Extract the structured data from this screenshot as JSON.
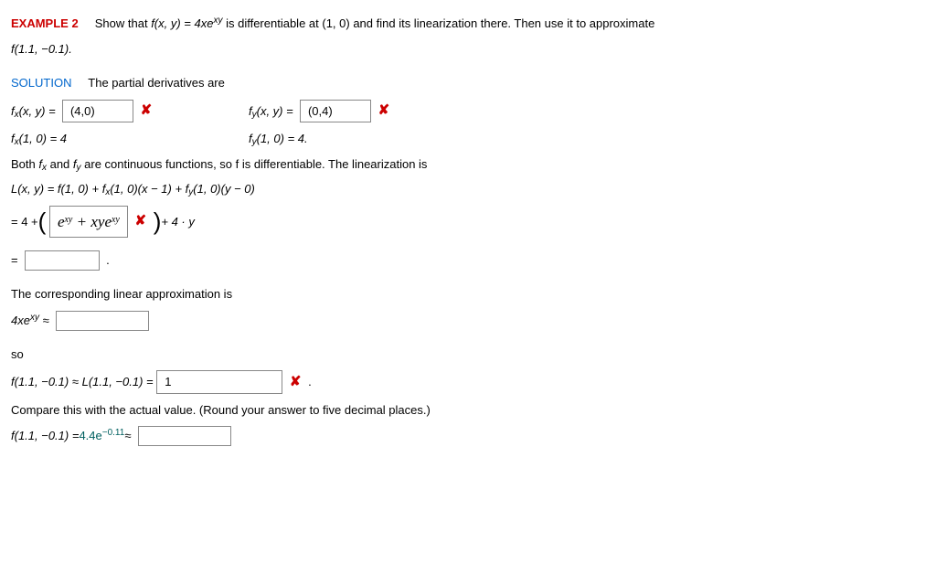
{
  "header": {
    "example_label": "EXAMPLE 2",
    "prompt_pre": "Show that ",
    "func_def": "f(x, y) = 4xe",
    "func_exp": "xy",
    "prompt_mid": " is differentiable at (1, 0) and find its linearization there. Then use it to approximate",
    "prompt_line2": "f(1.1, −0.1)."
  },
  "solution_label": "SOLUTION",
  "pd_intro": "The partial derivatives are",
  "fx_label": "f",
  "fx_args": "(x, y)  =",
  "fx_answer": "(4,0)",
  "fy_label": "f",
  "fy_args": "(x, y)  =",
  "fy_answer": "(0,4)",
  "fx10": "f",
  "fx10_rest": "(1, 0)  =  4",
  "fy10": "f",
  "fy10_rest": "(1, 0)  =  4.",
  "cont_text_pre": "Both ",
  "cont_text_mid": " and ",
  "cont_text_post": "  are continuous functions, so f is differentiable. The linearization is",
  "lin_line1": "L(x, y)  =  f(1, 0) + f",
  "lin_line1_b": "(1, 0)(x − 1) + f",
  "lin_line1_c": "(1, 0)(y − 0)",
  "lin_line2_pre": "=  4 + ",
  "lin_line2_ans_a": "e",
  "lin_line2_ans_mid": " + xye",
  "lin_line2_post": " + 4 · y",
  "eq_sign": "=",
  "approx_text": "The corresponding linear approximation is",
  "approx_lhs_a": "4xe",
  "approx_sym": "≈",
  "so_text": "so",
  "fL_line": "f(1.1, −0.1) ≈ L(1.1, −0.1)  =",
  "fL_answer": "1",
  "period": ".",
  "compare_text": "Compare this with the actual value. (Round your answer to five decimal places.)",
  "actual_line_a": "f(1.1, −0.1)  =  ",
  "actual_val": "4.4e",
  "actual_exp": "−0.11",
  "actual_sym": "  ≈",
  "wrong": "✘"
}
